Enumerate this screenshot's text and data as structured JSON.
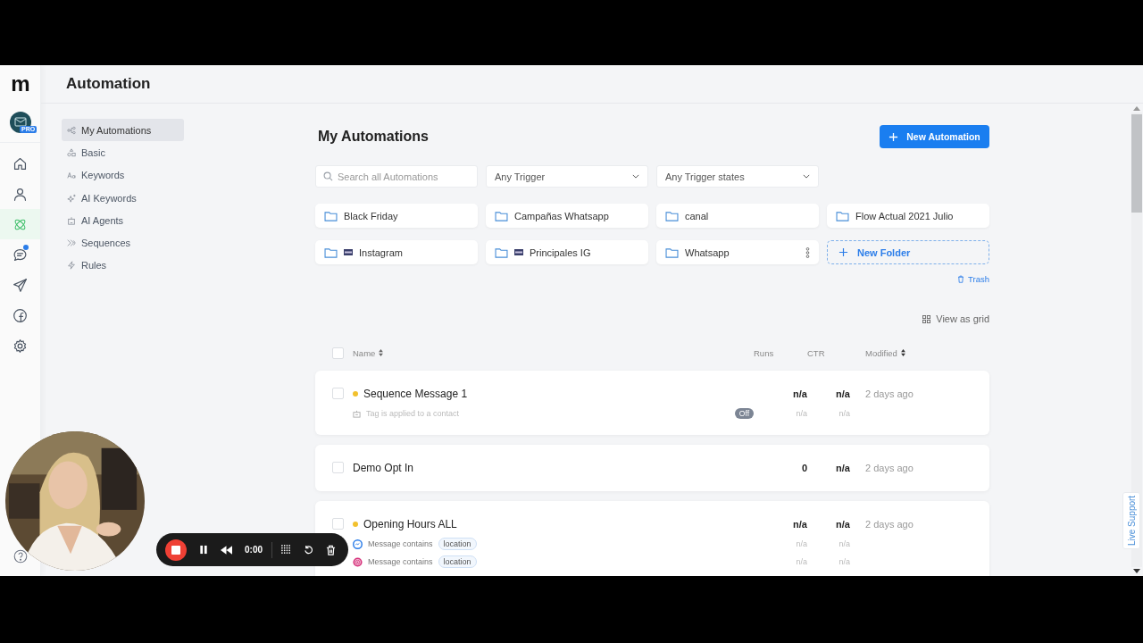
{
  "logo": "m",
  "header": {
    "title": "Automation"
  },
  "rail": {
    "plan_badge": "PRO",
    "items": [
      {
        "selected": false,
        "badge": false
      },
      {
        "selected": false,
        "badge": false
      },
      {
        "selected": true,
        "badge": false
      },
      {
        "selected": false,
        "badge": true
      },
      {
        "selected": false,
        "badge": false
      },
      {
        "selected": false,
        "badge": false
      },
      {
        "selected": false,
        "badge": false
      }
    ]
  },
  "subnav": [
    {
      "label": "My Automations",
      "selected": true
    },
    {
      "label": "Basic",
      "selected": false
    },
    {
      "label": "Keywords",
      "selected": false
    },
    {
      "label": "AI Keywords",
      "selected": false
    },
    {
      "label": "AI Agents",
      "selected": false
    },
    {
      "label": "Sequences",
      "selected": false
    },
    {
      "label": "Rules",
      "selected": false
    }
  ],
  "page": {
    "title": "My Automations",
    "new_button": "New Automation"
  },
  "filters": {
    "search": {
      "placeholder": "Search all Automations"
    },
    "trigger": "Any Trigger",
    "trigger_state": "Any Trigger states"
  },
  "folders": [
    {
      "name": "Black Friday",
      "flag": false,
      "menu": false
    },
    {
      "name": "Campañas Whatsapp",
      "flag": false,
      "menu": false
    },
    {
      "name": "canal",
      "flag": false,
      "menu": false
    },
    {
      "name": "Flow Actual 2021 Julio",
      "flag": false,
      "menu": false
    },
    {
      "name": "Instagram",
      "flag": true,
      "menu": false
    },
    {
      "name": "Principales IG",
      "flag": true,
      "menu": false
    },
    {
      "name": "Whatsapp",
      "flag": false,
      "menu": true
    }
  ],
  "new_folder": "New Folder",
  "trash": "Trash",
  "view_toggle": "View as grid",
  "table": {
    "select_all": false,
    "columns": {
      "name": "Name",
      "runs": "Runs",
      "ctr": "CTR",
      "modified": "Modified"
    },
    "rows": [
      {
        "name": "Sequence Message 1",
        "checked": false,
        "status_dot": true,
        "runs": "n/a",
        "ctr": "n/a",
        "modified": "2 days ago",
        "triggers": [
          {
            "kind": "tag",
            "text": "Tag is applied to a contact",
            "status": "Off",
            "runs": "n/a",
            "ctr": "n/a"
          }
        ]
      },
      {
        "name": "Demo Opt In",
        "checked": false,
        "status_dot": false,
        "runs": "0",
        "ctr": "n/a",
        "modified": "2 days ago"
      },
      {
        "name": "Opening Hours ALL",
        "checked": false,
        "status_dot": true,
        "runs": "n/a",
        "ctr": "n/a",
        "modified": "2 days ago",
        "triggers": [
          {
            "kind": "messenger",
            "text": "Message contains",
            "keyword": "location",
            "runs": "n/a",
            "ctr": "n/a"
          },
          {
            "kind": "instagram",
            "text": "Message contains",
            "keyword": "location",
            "runs": "n/a",
            "ctr": "n/a"
          }
        ]
      }
    ]
  },
  "recorder": {
    "time": "0:00"
  },
  "live_support": "Live Support"
}
